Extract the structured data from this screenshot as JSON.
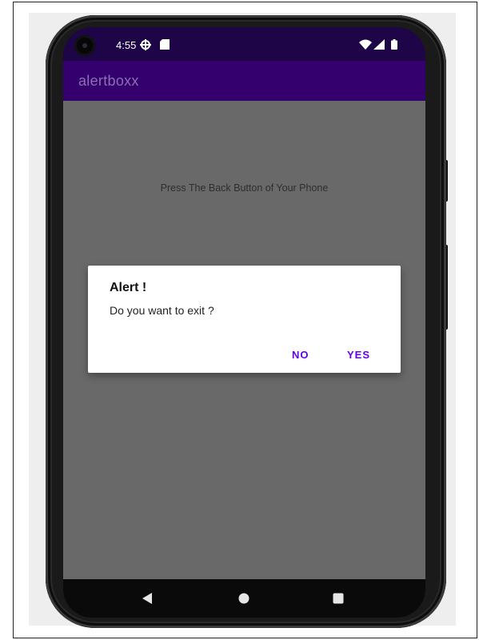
{
  "status_bar": {
    "time": "4:55",
    "icons": [
      "camera-cutout",
      "settings-sync-icon",
      "sd-card-icon",
      "wifi-icon",
      "signal-icon",
      "battery-icon"
    ]
  },
  "app_bar": {
    "title": "alertboxx"
  },
  "main": {
    "message": "Press The Back Button of Your Phone"
  },
  "dialog": {
    "title": "Alert !",
    "message": "Do you want to exit ?",
    "negative_label": "NO",
    "positive_label": "YES"
  },
  "nav_bar": {
    "buttons": [
      "back-icon",
      "home-icon",
      "recents-icon"
    ]
  },
  "colors": {
    "status_bar": "#1e0547",
    "app_bar": "#34006e",
    "app_title": "#8d6eb5",
    "scrim": "#696969",
    "dialog_button": "#6200ee"
  }
}
